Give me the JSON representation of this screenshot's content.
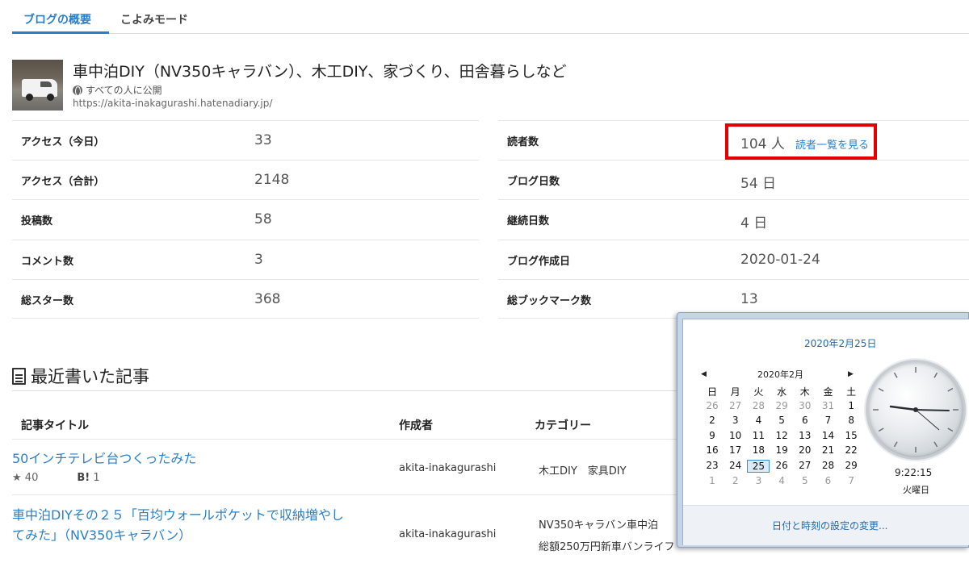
{
  "tabs": [
    {
      "label": "ブログの概要",
      "active": true
    },
    {
      "label": "こよみモード",
      "active": false
    }
  ],
  "blog": {
    "title": "車中泊DIY（NV350キャラバン）、木工DIY、家づくり、田舎暮らしなど",
    "visibility": "すべての人に公開",
    "url": "https://akita-inakagurashi.hatenadiary.jp/"
  },
  "stats_left": [
    {
      "label": "アクセス（今日）",
      "value": "33"
    },
    {
      "label": "アクセス（合計）",
      "value": "2148"
    },
    {
      "label": "投稿数",
      "value": "58"
    },
    {
      "label": "コメント数",
      "value": "3"
    },
    {
      "label": "総スター数",
      "value": "368"
    }
  ],
  "stats_right": [
    {
      "label": "読者数",
      "value": "104 人"
    },
    {
      "label": "ブログ日数",
      "value": "54 日"
    },
    {
      "label": "継続日数",
      "value": "4 日"
    },
    {
      "label": "ブログ作成日",
      "value": "2020-01-24"
    },
    {
      "label": "総ブックマーク数",
      "value": "13"
    }
  ],
  "readers_link": "読者一覧を見る",
  "recent": {
    "heading": "最近書いた記事",
    "columns": [
      "記事タイトル",
      "作成者",
      "カテゴリー"
    ],
    "articles": [
      {
        "title": "50インチテレビ台つくったみた",
        "author": "akita-inakagurashi",
        "category": "木工DIY　家具DIY",
        "stars": "40",
        "bookmark_label": "B!",
        "bookmarks": "1"
      },
      {
        "title_line1": "車中泊DIYその２５「百均ウォールポケットで収納増やし",
        "title_line2": "てみた」（NV350キャラバン）",
        "author": "akita-inakagurashi",
        "category_line1": "NV350キャラバン車中泊",
        "category_line2": "総額250万円新車バンライフ"
      }
    ]
  },
  "calendar": {
    "full_date": "2020年2月25日",
    "month_label": "2020年2月",
    "weekdays": [
      "日",
      "月",
      "火",
      "水",
      "木",
      "金",
      "土"
    ],
    "weeks": [
      [
        "26",
        "27",
        "28",
        "29",
        "30",
        "31",
        "1"
      ],
      [
        "2",
        "3",
        "4",
        "5",
        "6",
        "7",
        "8"
      ],
      [
        "9",
        "10",
        "11",
        "12",
        "13",
        "14",
        "15"
      ],
      [
        "16",
        "17",
        "18",
        "19",
        "20",
        "21",
        "22"
      ],
      [
        "23",
        "24",
        "25",
        "26",
        "27",
        "28",
        "29"
      ],
      [
        "1",
        "2",
        "3",
        "4",
        "5",
        "6",
        "7"
      ]
    ],
    "today": "25",
    "time": "9:22:15",
    "day_name": "火曜日",
    "settings_link": "日付と時刻の設定の変更..."
  },
  "colors": {
    "accent": "#2a7fc8",
    "highlight_box": "#e00000"
  }
}
